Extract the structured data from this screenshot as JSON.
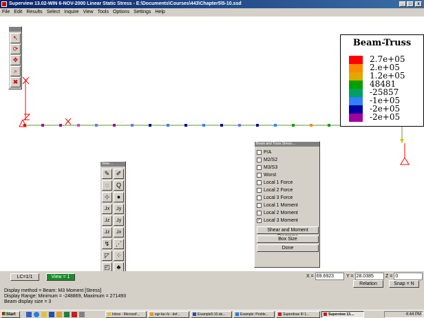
{
  "window": {
    "title": "Superview 13.02-WIN 6-NOV-2000 Linear Static Stress - E:\\Documents\\Courses\\443\\Chapter5\\5-10.ssd"
  },
  "menu": [
    "File",
    "Edit",
    "Results",
    "Select",
    "Inquire",
    "View",
    "Tools",
    "Options",
    "Settings",
    "Help"
  ],
  "legend": {
    "title": "Beam-Truss",
    "entries": [
      {
        "value": "2.7e+05",
        "color": "#ff0000"
      },
      {
        "value": "2.e+05",
        "color": "#ff8800"
      },
      {
        "value": "1.2e+05",
        "color": "#e0a800"
      },
      {
        "value": "48481",
        "color": "#00a000"
      },
      {
        "value": "-25857",
        "color": "#00a060"
      },
      {
        "value": "-1e+05",
        "color": "#3080ff"
      },
      {
        "value": "-2e+05",
        "color": "#0000a0"
      },
      {
        "value": "-2e+05",
        "color": "#a000a0"
      }
    ]
  },
  "model": {
    "beam_color": "#7aaa5a",
    "node_colors": [
      "#ff0000",
      "#a000a0",
      "#a000a0",
      "#cc44cc",
      "#7070ff",
      "#a000a0",
      "#7070ff",
      "#0000a0",
      "#3080ff",
      "#0000a0",
      "#3080ff",
      "#0000a0",
      "#7070ff",
      "#0000a0",
      "#3080ff",
      "#00a000",
      "#ff8800",
      "#00a000",
      "#e0a800",
      "#e0a800",
      "#ff0000",
      "#ff0000"
    ]
  },
  "toolbar_small": {
    "title": "",
    "buttons": [
      "select-arrow-icon",
      "rotate-icon",
      "pan-icon",
      "zoom-icon",
      "delete-icon"
    ]
  },
  "view_palette": {
    "title": "View ...",
    "buttons": [
      "pencil-icon",
      "brush-icon",
      "rotate-icon",
      "zoom-in-icon",
      "fit-icon",
      "sphere-icon",
      "axis-x-icon",
      "axis-y-icon",
      "axis-z-icon",
      "axis-xy-icon",
      "axis-yz-icon",
      "axis-zx-icon",
      "iso-icon",
      "perspective-icon",
      "grid-icon",
      "measure-icon",
      "shade-icon",
      "color-icon",
      "zoom-icon",
      "zoom-out-icon"
    ]
  },
  "beam_panel": {
    "title": "Beam and Truss Stress ...",
    "options": [
      {
        "label": "P/A",
        "checked": false
      },
      {
        "label": "M2/S2",
        "checked": false
      },
      {
        "label": "M3/S3",
        "checked": false
      },
      {
        "label": "Worst",
        "checked": false
      },
      {
        "label": "Local 1 Force",
        "checked": false
      },
      {
        "label": "Local 2 Force",
        "checked": false
      },
      {
        "label": "Local 3 Force",
        "checked": false
      },
      {
        "label": "Local 1 Moment",
        "checked": false
      },
      {
        "label": "Local 2 Moment",
        "checked": false
      },
      {
        "label": "Local 3 Moment",
        "checked": true
      }
    ],
    "buttons": [
      "Shear and Moment Diagrams",
      "Box Size",
      "Done"
    ]
  },
  "status": {
    "lc": "LC=1/1",
    "view": "View = 1",
    "x_label": "X =",
    "x_value": "69.6923",
    "y_label": "Y =",
    "y_value": "28.0385",
    "z_label": "Z =",
    "z_value": "0",
    "relation": "Relation",
    "snap": "Snap = N",
    "info": [
      "Display method = Beam: M3 Moment [Stress]",
      "Display Range: Minimum = -248869, Maximum = 271493",
      "Beam display size = 3"
    ]
  },
  "taskbar": {
    "start": "Start",
    "tasks": [
      "Inbox - Microsof...",
      "egr-fac-fs - def...",
      "Example5-10.do...",
      "Example: Proble...",
      "Superdraw III 1...",
      "Superview 13...."
    ],
    "active_index": 5,
    "time": "4:44 PM"
  }
}
